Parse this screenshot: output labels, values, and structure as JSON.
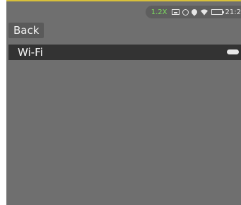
{
  "status_bar": {
    "zoom": "1.2X",
    "clock": "21:2",
    "icons": [
      "screen-icon",
      "globe-icon",
      "location-icon",
      "wifi-signal-icon",
      "battery-icon"
    ]
  },
  "nav": {
    "back_label": "Back"
  },
  "settings": {
    "wifi_label": "Wi-Fi",
    "wifi_enabled": false
  },
  "colors": {
    "background": "#6f6f6f",
    "row": "#333333",
    "accent_zoom": "#7ddc5f",
    "top_accent": "#d8c03a"
  }
}
